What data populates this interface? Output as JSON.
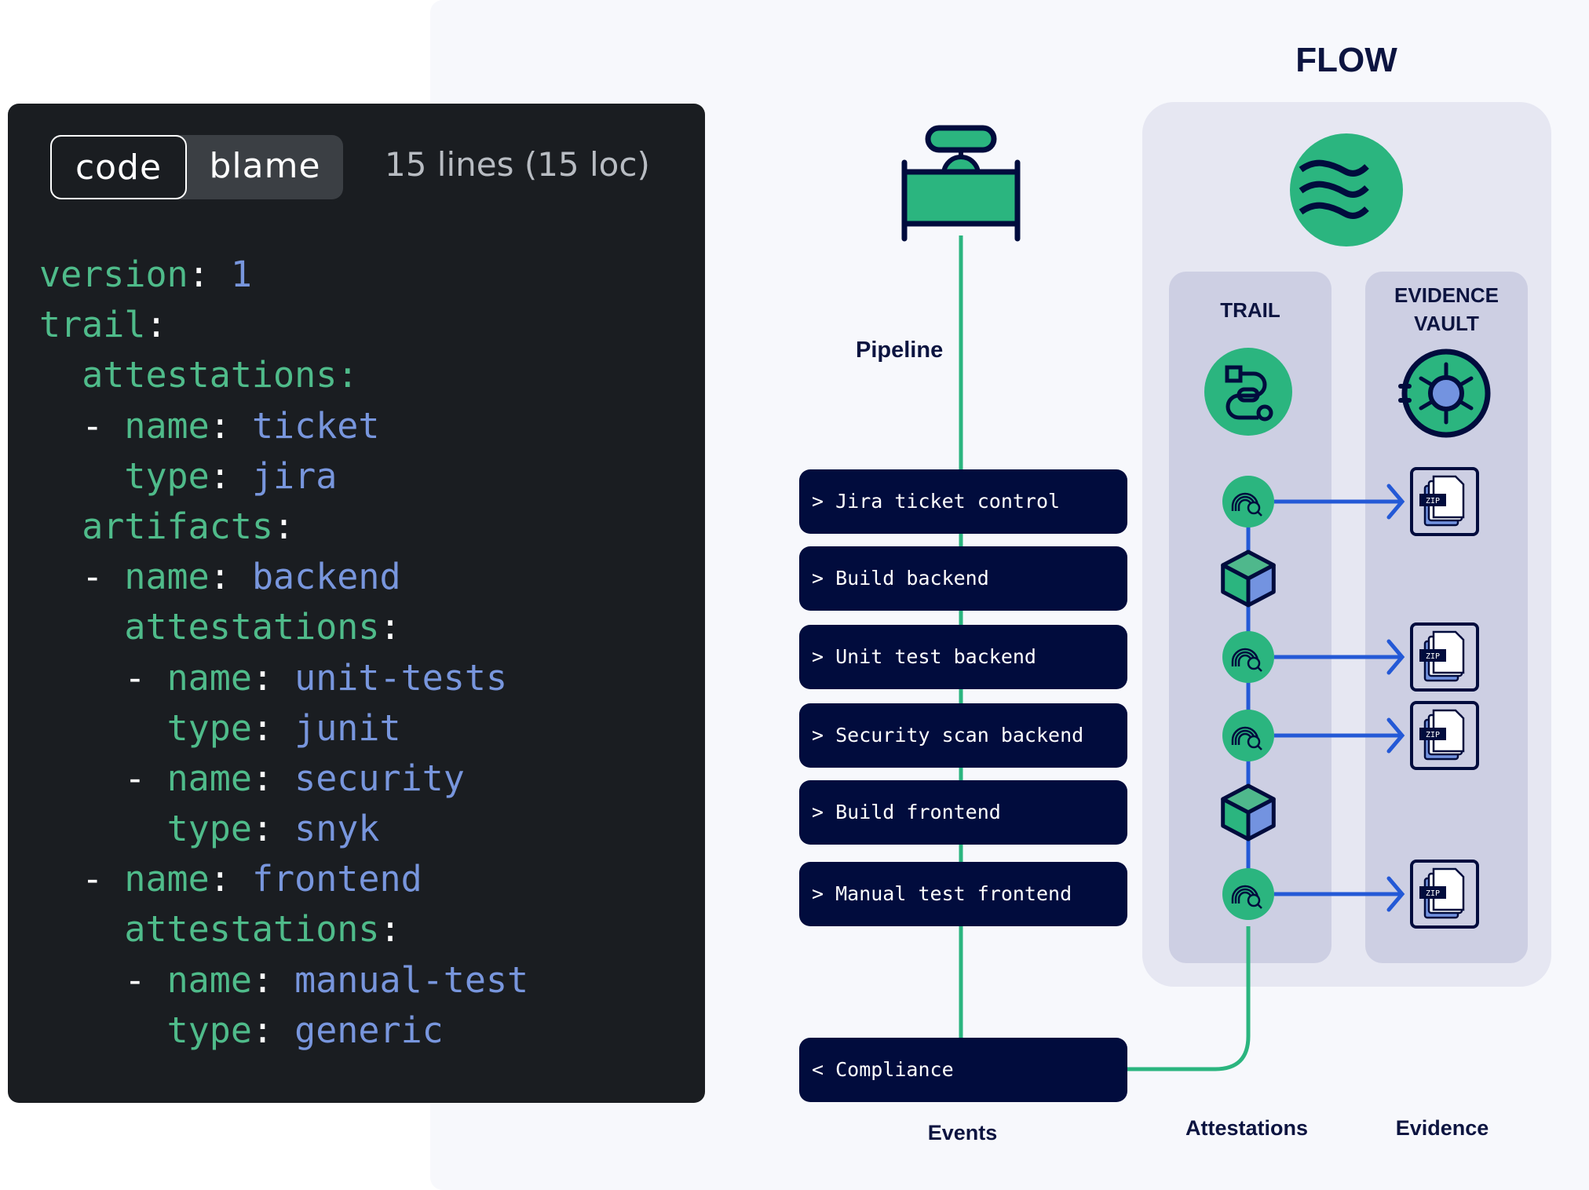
{
  "code_panel": {
    "tabs": [
      {
        "label": "code",
        "active": true
      },
      {
        "label": "blame",
        "active": false
      }
    ],
    "line_count": "15 lines (15 loc)",
    "lines": [
      {
        "indent": "",
        "dash": "",
        "key": "version",
        "value": "1"
      },
      {
        "indent": "",
        "dash": "",
        "key": "trail",
        "value": ""
      },
      {
        "indent": "  ",
        "dash": "",
        "key": "attestations",
        "value": ""
      },
      {
        "indent": "  ",
        "dash": "- ",
        "key": "name",
        "value": "ticket"
      },
      {
        "indent": "    ",
        "dash": "",
        "key": "type",
        "value": "jira"
      },
      {
        "indent": "  ",
        "dash": "",
        "key": "artifacts",
        "value": ""
      },
      {
        "indent": "  ",
        "dash": "- ",
        "key": "name",
        "value": "backend"
      },
      {
        "indent": "    ",
        "dash": "",
        "key": "attestations",
        "value": ""
      },
      {
        "indent": "    ",
        "dash": "- ",
        "key": "name",
        "value": "unit-tests"
      },
      {
        "indent": "      ",
        "dash": "",
        "key": "type",
        "value": "junit"
      },
      {
        "indent": "    ",
        "dash": "- ",
        "key": "name",
        "value": "security"
      },
      {
        "indent": "      ",
        "dash": "",
        "key": "type",
        "value": "snyk"
      },
      {
        "indent": "  ",
        "dash": "- ",
        "key": "name",
        "value": "frontend"
      },
      {
        "indent": "    ",
        "dash": "",
        "key": "attestations",
        "value": ""
      },
      {
        "indent": "    ",
        "dash": "- ",
        "key": "name",
        "value": "manual-test"
      },
      {
        "indent": "      ",
        "dash": "",
        "key": "type",
        "value": "generic"
      }
    ]
  },
  "diagram": {
    "flow_title": "FLOW",
    "trail_title": "TRAIL",
    "vault_title_line1": "EVIDENCE",
    "vault_title_line2": "VAULT",
    "pipeline_label": "Pipeline",
    "events": [
      {
        "label": "> Jira ticket control",
        "attestation": "fingerprint",
        "evidence": true
      },
      {
        "label": "> Build backend",
        "attestation": "artifact",
        "evidence": false
      },
      {
        "label": "> Unit test backend",
        "attestation": "fingerprint",
        "evidence": true
      },
      {
        "label": "> Security scan backend",
        "attestation": "fingerprint",
        "evidence": true
      },
      {
        "label": "> Build frontend",
        "attestation": "artifact",
        "evidence": false
      },
      {
        "label": "> Manual test frontend",
        "attestation": "fingerprint",
        "evidence": true
      }
    ],
    "compliance_label": "< Compliance",
    "zip_label": "ZIP",
    "bottom_labels": {
      "events": "Events",
      "attestations": "Attestations",
      "evidence": "Evidence"
    },
    "icons": {
      "pipeline": "valve-icon",
      "flow": "waves-icon",
      "trail": "route-icon",
      "vault": "vault-icon",
      "attestation": "fingerprint-search-icon",
      "artifact": "cube-icon",
      "evidence": "zip-files-icon"
    },
    "colors": {
      "navy": "#010c3d",
      "green": "#2bb57f",
      "blue": "#2459d6",
      "light_blue": "#7393e0"
    }
  }
}
